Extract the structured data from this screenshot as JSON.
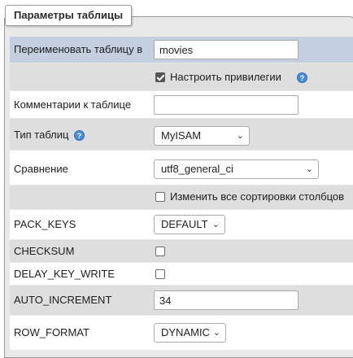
{
  "panel": {
    "legend": "Параметры таблицы"
  },
  "rows": {
    "rename": {
      "label": "Переименовать таблицу в",
      "value": "movies"
    },
    "privileges": {
      "label": "Настроить привилегии",
      "checked": true,
      "help_icon": "help-icon"
    },
    "comments": {
      "label": "Комментарии к таблице",
      "value": ""
    },
    "engine": {
      "label": "Тип таблиц",
      "value": "MyISAM",
      "help_icon": "help-icon"
    },
    "collation": {
      "label": "Сравнение",
      "value": "utf8_general_ci"
    },
    "change_all": {
      "label": "Изменить все сортировки столбцов",
      "checked": false
    },
    "pack_keys": {
      "label": "PACK_KEYS",
      "value": "DEFAULT"
    },
    "checksum": {
      "label": "CHECKSUM",
      "checked": false
    },
    "delay_key_write": {
      "label": "DELAY_KEY_WRITE",
      "checked": false
    },
    "auto_increment": {
      "label": "AUTO_INCREMENT",
      "value": "34"
    },
    "row_format": {
      "label": "ROW_FORMAT",
      "value": "DYNAMIC"
    }
  },
  "colors": {
    "highlight_row": "#c4cfe0",
    "panel_bg": "#e9e9e9",
    "help_icon": "#4a8bd8"
  }
}
